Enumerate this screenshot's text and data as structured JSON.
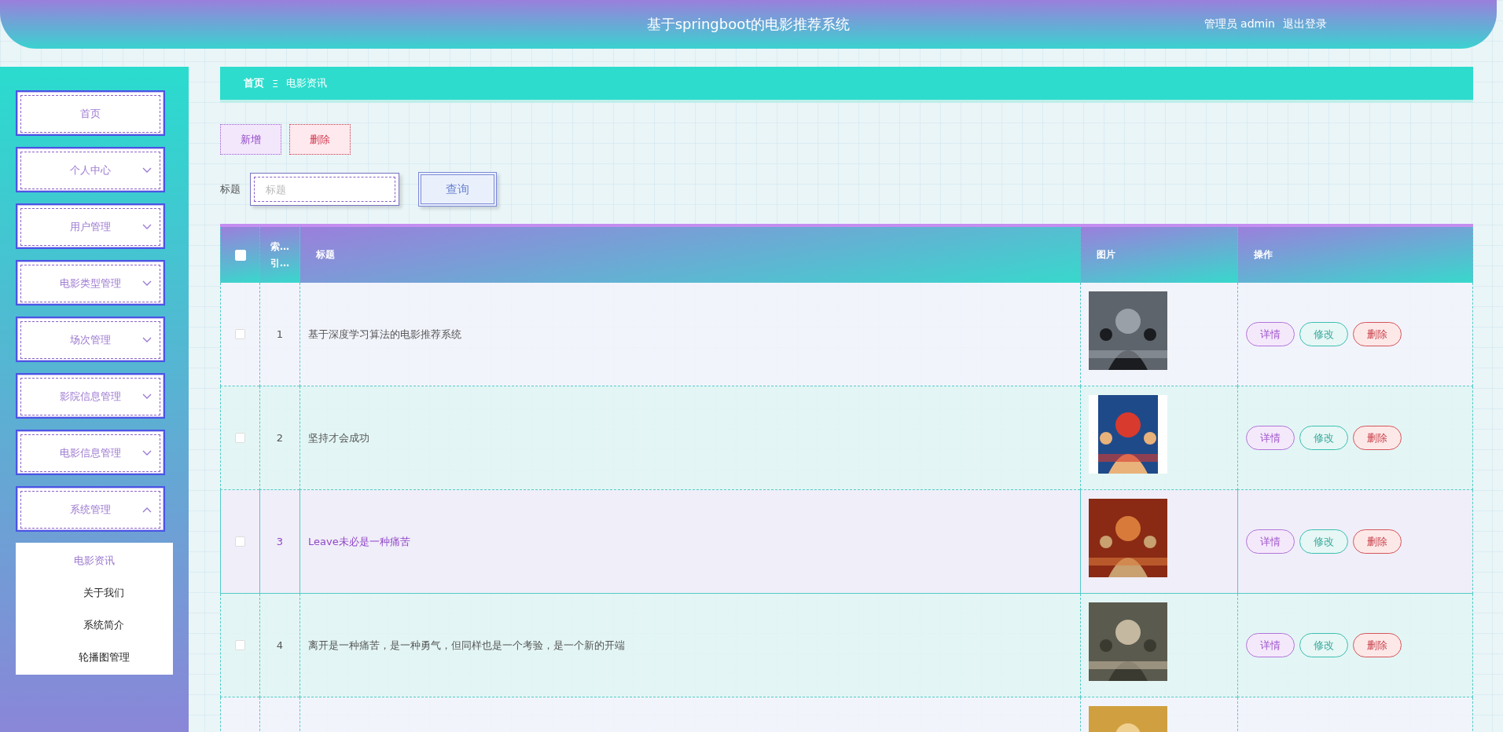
{
  "header": {
    "title": "基于springboot的电影推荐系统",
    "user": "管理员 admin",
    "logout": "退出登录"
  },
  "sidebar": {
    "items": [
      {
        "label": "首页"
      },
      {
        "label": "个人中心",
        "expanded": false
      },
      {
        "label": "用户管理",
        "expanded": false
      },
      {
        "label": "电影类型管理",
        "expanded": false
      },
      {
        "label": "场次管理",
        "expanded": false
      },
      {
        "label": "影院信息管理",
        "expanded": false
      },
      {
        "label": "电影信息管理",
        "expanded": false
      },
      {
        "label": "系统管理",
        "expanded": true,
        "children": [
          {
            "label": "电影资讯",
            "selected": true
          },
          {
            "label": "关于我们",
            "selected": false
          },
          {
            "label": "系统简介",
            "selected": false
          },
          {
            "label": "轮播图管理",
            "selected": false
          }
        ]
      }
    ]
  },
  "breadcrumb": {
    "home": "首页",
    "separator": "Ξ",
    "current": "电影资讯"
  },
  "toolbar": {
    "add": "新增",
    "delete": "删除"
  },
  "search": {
    "label": "标题",
    "placeholder": "标题",
    "button": "查询"
  },
  "table": {
    "columns": [
      "索… 引…",
      "标题",
      "图片",
      "操作"
    ],
    "header_checked": false,
    "rows": [
      {
        "index": "1",
        "title": "基于深度学习算法的电影推荐系统",
        "checked": false,
        "highlighted": false,
        "image": {
          "kind": "picture"
        },
        "actions": [
          "详情",
          "修改",
          "删除"
        ]
      },
      {
        "index": "2",
        "title": "坚持才会成功",
        "checked": false,
        "highlighted": false,
        "image": {
          "kind": "picture"
        },
        "actions": [
          "详情",
          "修改",
          "删除"
        ]
      },
      {
        "index": "3",
        "title": "Leave未必是一种痛苦",
        "checked": false,
        "highlighted": true,
        "image": {
          "kind": "picture"
        },
        "actions": [
          "详情",
          "修改",
          "删除"
        ]
      },
      {
        "index": "4",
        "title": "离开是一种痛苦，是一种勇气，但同样也是一个考验，是一个新的开端",
        "checked": false,
        "highlighted": false,
        "image": {
          "kind": "picture"
        },
        "actions": [
          "详情",
          "修改",
          "删除"
        ]
      },
      {
        "image": {
          "kind": "picture"
        }
      }
    ]
  }
}
